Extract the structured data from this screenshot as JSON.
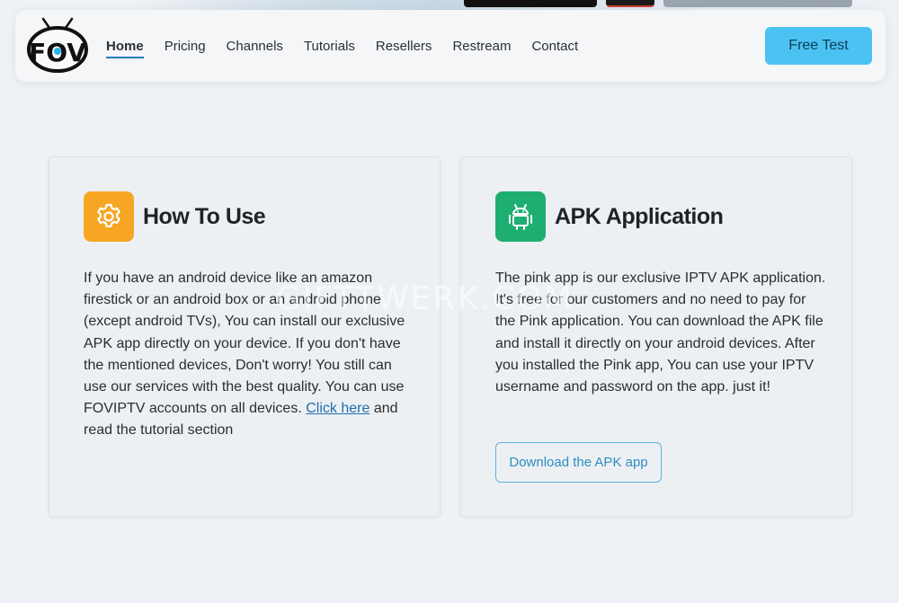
{
  "nav": {
    "logo_text": "FOV",
    "links": [
      {
        "label": "Home",
        "active": true
      },
      {
        "label": "Pricing"
      },
      {
        "label": "Channels"
      },
      {
        "label": "Tutorials"
      },
      {
        "label": "Resellers"
      },
      {
        "label": "Restream"
      },
      {
        "label": "Contact"
      }
    ],
    "cta_label": "Free Test"
  },
  "cards": {
    "how_to_use": {
      "icon": "gear-icon",
      "title": "How To Use",
      "text_before_link": "If you have an android device like an amazon firestick or an android box or an android phone (except android TVs), You can install our exclusive APK app directly on your device. If you don't have the mentioned devices, Don't worry! You still can use our services with the best quality. You can use FOVIPTV accounts on all devices.",
      "link_label": "Click here",
      "text_after_link": "and read the tutorial section"
    },
    "apk_application": {
      "icon": "android-icon",
      "title": "APK Application",
      "text": "The pink app is our exclusive IPTV APK application. It's free for our customers and no need to pay for the Pink application. You can download the APK file and install it directly on your android devices. After you installed the Pink app, You can use your IPTV username and password on the app. just it!",
      "button_label": "Download the APK app"
    }
  },
  "watermark": "GIFTTWERK.COM",
  "colors": {
    "accent_blue": "#4bc2f2",
    "gear_orange": "#f6a623",
    "android_green": "#1fae72",
    "link_blue": "#1f6db0"
  }
}
